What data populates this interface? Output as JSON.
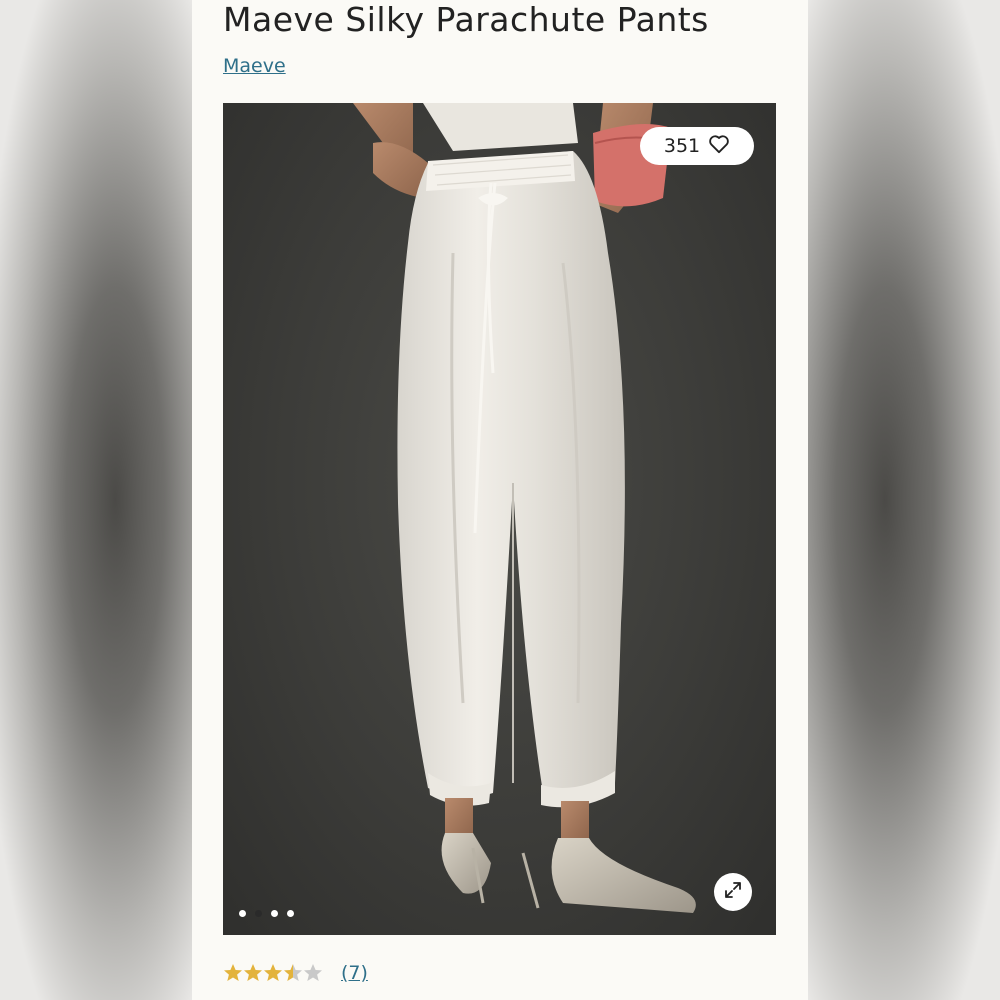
{
  "product": {
    "title": "Maeve Silky Parachute Pants",
    "brand": "Maeve"
  },
  "gallery": {
    "like_count": "351",
    "like_icon": "heart-icon",
    "expand_icon": "expand-icon",
    "slide_count": 4,
    "active_slide": 2
  },
  "rating": {
    "value": 3.5,
    "max": 5,
    "reviews_label": "(7)"
  },
  "colors": {
    "link": "#2e6f89",
    "star_filled": "#e3b33c",
    "star_empty": "#c9c9c9",
    "panel_bg": "#fbfaf6"
  }
}
